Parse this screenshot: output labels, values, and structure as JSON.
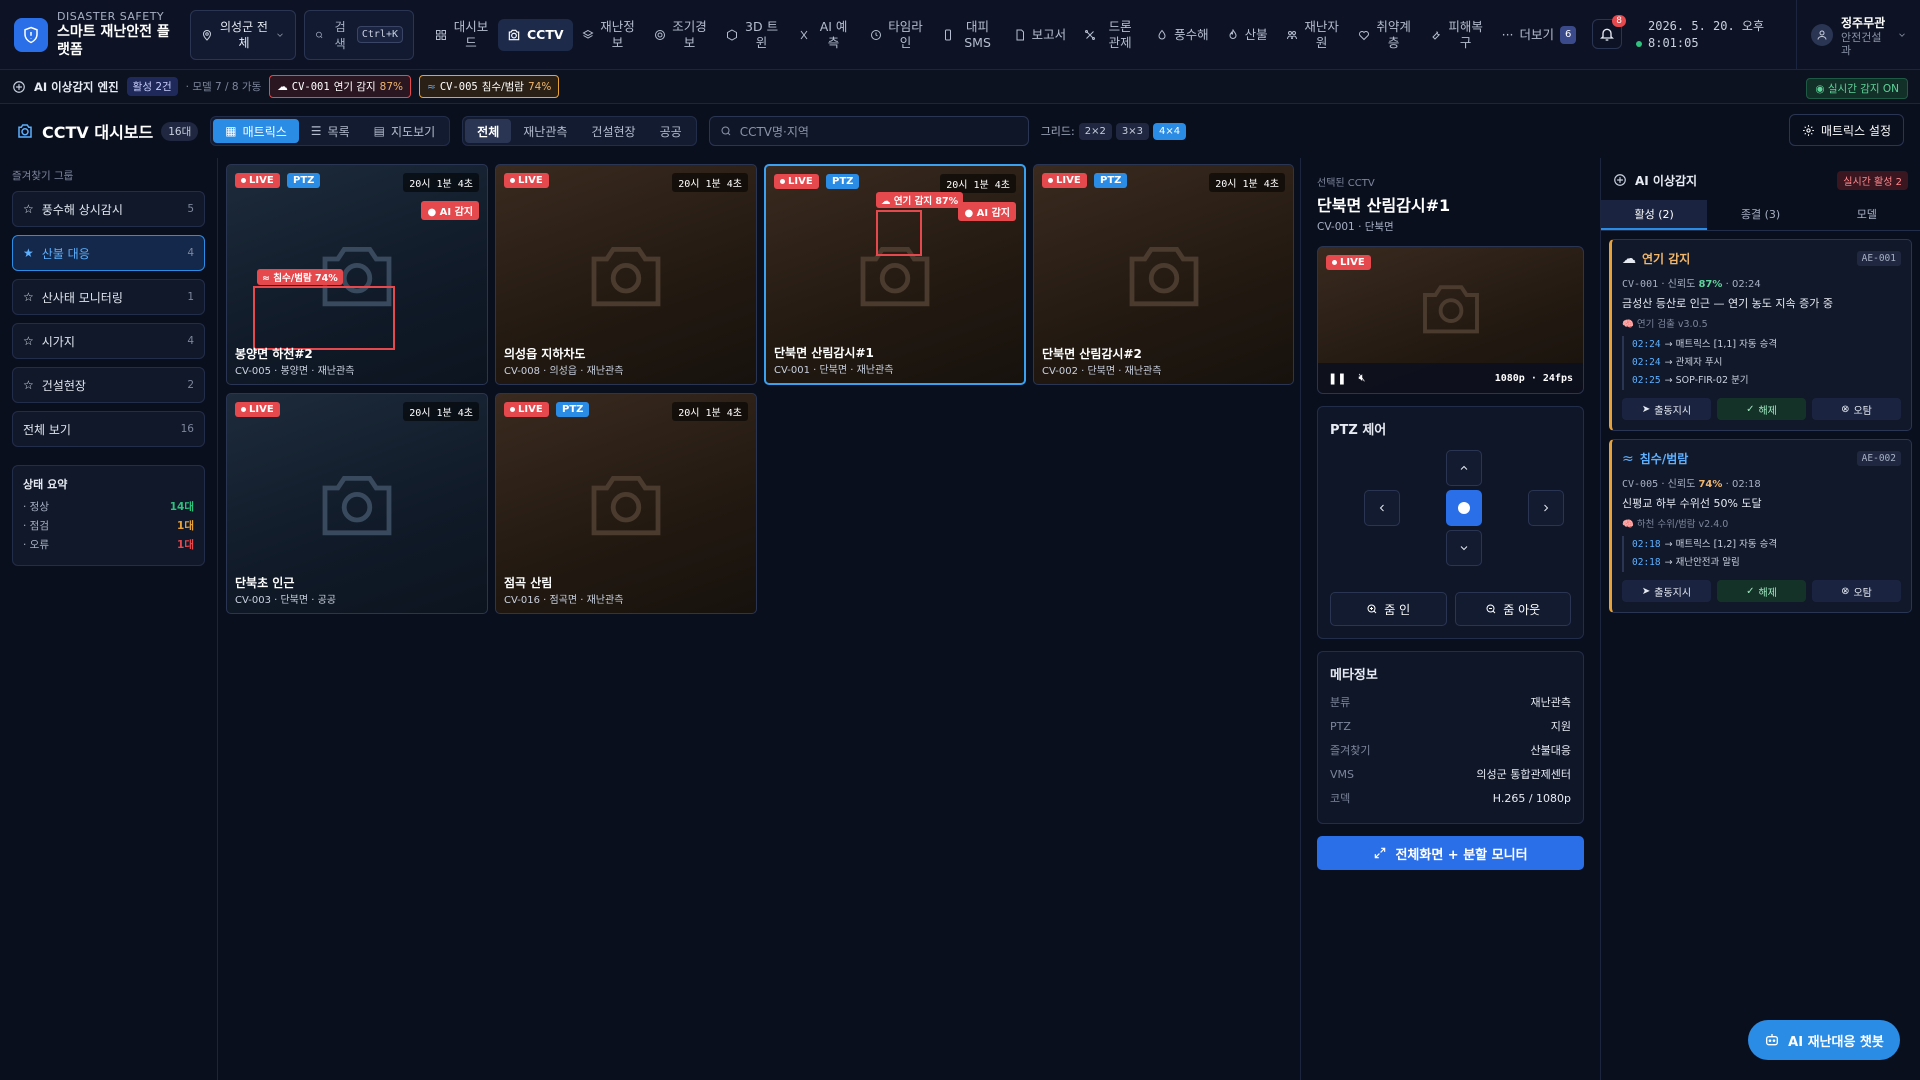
{
  "brand": {
    "sub": "DISASTER SAFETY",
    "title": "스마트 재난안전 플랫폼"
  },
  "region": {
    "label": "의성군 전체"
  },
  "search": {
    "label": "검색",
    "shortcut": "Ctrl+K"
  },
  "nav": [
    {
      "label": "대시보드",
      "icon": "grid-icon"
    },
    {
      "label": "CCTV",
      "icon": "camera-icon",
      "active": true
    },
    {
      "label": "재난정보",
      "icon": "layers-icon"
    },
    {
      "label": "조기경보",
      "icon": "radar-icon"
    },
    {
      "label": "3D 트윈",
      "icon": "cube-icon"
    },
    {
      "label": "AI 예측",
      "icon": "ai-icon"
    },
    {
      "label": "타임라인",
      "icon": "clock-icon"
    },
    {
      "label": "대피 SMS",
      "icon": "phone-icon"
    },
    {
      "label": "보고서",
      "icon": "document-icon"
    },
    {
      "label": "드론 관제",
      "icon": "drone-icon"
    },
    {
      "label": "풍수해",
      "icon": "storm-icon"
    },
    {
      "label": "산불",
      "icon": "fire-icon"
    },
    {
      "label": "재난자원",
      "icon": "resource-icon"
    },
    {
      "label": "취약계층",
      "icon": "heart-icon"
    },
    {
      "label": "피해복구",
      "icon": "wrench-icon"
    },
    {
      "label": "더보기",
      "icon": "more-icon",
      "badge": "6"
    }
  ],
  "notifications": {
    "count": "8"
  },
  "clock": {
    "date": "2026. 5. 20. 오후",
    "time": "8:01:05"
  },
  "user": {
    "name": "정주무관",
    "role": "안전건설과"
  },
  "ai_strip": {
    "engine": "AI 이상감지 엔진",
    "active": "활성 2건",
    "models": "· 모델 7 / 8 가동",
    "alerts": [
      {
        "cam": "CV-001",
        "text": "연기 감지",
        "pct": "87%"
      },
      {
        "cam": "CV-005",
        "text": "침수/범람",
        "pct": "74%"
      }
    ],
    "realtime": "실시간 감지 ON"
  },
  "dashboard": {
    "title": "CCTV 대시보드",
    "count": "16대",
    "views": [
      "매트릭스",
      "목록",
      "지도보기"
    ],
    "filters": [
      "전체",
      "재난관측",
      "건설현장",
      "공공"
    ],
    "search_placeholder": "CCTV명·지역",
    "grid_label": "그리드:",
    "grids": [
      "2×2",
      "3×3",
      "4×4"
    ],
    "settings": "매트릭스 설정"
  },
  "sidebar": {
    "group_label": "즐겨찾기 그룹",
    "items": [
      {
        "label": "풍수해 상시감시",
        "count": "5"
      },
      {
        "label": "산불 대응",
        "count": "4",
        "active": true
      },
      {
        "label": "산사태 모니터링",
        "count": "1"
      },
      {
        "label": "시가지",
        "count": "4"
      },
      {
        "label": "건설현장",
        "count": "2"
      },
      {
        "label": "전체 보기",
        "count": "16"
      }
    ],
    "summary": {
      "title": "상태 요약",
      "rows": [
        {
          "label": "· 정상",
          "value": "14대",
          "color": "#2ec27e"
        },
        {
          "label": "· 점검",
          "value": "1대",
          "color": "#e8a23a"
        },
        {
          "label": "· 오류",
          "value": "1대",
          "color": "#e5484d"
        }
      ]
    }
  },
  "tiles": [
    {
      "live": "LIVE",
      "ptz": "PTZ",
      "time": "20시 1분 4초",
      "ai": "AI 감지",
      "name": "봉양면 하천#2",
      "meta": "CV-005 · 봉양면 · 재난관측",
      "detection": "침수/범람 74%"
    },
    {
      "live": "LIVE",
      "time": "20시 1분 4초",
      "name": "의성읍 지하차도",
      "meta": "CV-008 · 의성읍 · 재난관측"
    },
    {
      "live": "LIVE",
      "ptz": "PTZ",
      "time": "20시 1분 4초",
      "ai": "AI 감지",
      "name": "단북면 산림감시#1",
      "meta": "CV-001 · 단북면 · 재난관측",
      "detection": "연기 감지 87%"
    },
    {
      "live": "LIVE",
      "ptz": "PTZ",
      "time": "20시 1분 4초",
      "name": "단북면 산림감시#2",
      "meta": "CV-002 · 단북면 · 재난관측"
    },
    {
      "live": "LIVE",
      "time": "20시 1분 4초",
      "name": "단북초 인근",
      "meta": "CV-003 · 단북면 · 공공"
    },
    {
      "live": "LIVE",
      "ptz": "PTZ",
      "time": "20시 1분 4초",
      "name": "점곡 산림",
      "meta": "CV-016 · 점곡면 · 재난관측"
    }
  ],
  "detail": {
    "selected_label": "선택된 CCTV",
    "name": "단북면 산림감시#1",
    "meta": "CV-001 · 단북면",
    "live": "LIVE",
    "resolution": "1080p · 24fps",
    "ptz_title": "PTZ 제어",
    "zoom_in": "줌 인",
    "zoom_out": "줌 아웃",
    "meta_title": "메타정보",
    "meta_rows": [
      {
        "k": "분류",
        "v": "재난관측"
      },
      {
        "k": "PTZ",
        "v": "지원"
      },
      {
        "k": "즐겨찾기",
        "v": "산불대응"
      },
      {
        "k": "VMS",
        "v": "의성군 통합관제센터"
      },
      {
        "k": "코덱",
        "v": "H.265 / 1080p"
      }
    ],
    "fullscreen": "전체화면 + 분할 모니터"
  },
  "aipanel": {
    "title": "AI 이상감지",
    "active": "실시간 활성 2",
    "tabs": [
      "활성 (2)",
      "종결 (3)",
      "모델"
    ],
    "cards": [
      {
        "title": "연기 감지",
        "id": "AE-001",
        "cam": "CV-001",
        "conf_label": "· 신뢰도",
        "conf": "87%",
        "time": "· 02:24",
        "desc": "금성산 등산로 인근 — 연기 농도 지속 증가 중",
        "model": "연기 검출 v3.0.5",
        "steps": [
          {
            "t": "02:24",
            "s": "→ 매트릭스 [1,1] 자동 승격"
          },
          {
            "t": "02:24",
            "s": "→ 관제자 푸시"
          },
          {
            "t": "02:25",
            "s": "→ SOP-FIR-02 분기"
          }
        ]
      },
      {
        "title": "침수/범람",
        "id": "AE-002",
        "cam": "CV-005",
        "conf_label": "· 신뢰도",
        "conf": "74%",
        "time": "· 02:18",
        "desc": "신평교 하부 수위선 50% 도달",
        "model": "하천 수위/범람 v2.4.0",
        "steps": [
          {
            "t": "02:18",
            "s": "→ 매트릭스 [1,2] 자동 승격"
          },
          {
            "t": "02:18",
            "s": "→ 재난안전과 알림"
          }
        ]
      }
    ],
    "actions": [
      "출동지시",
      "해제",
      "오탐"
    ]
  },
  "chatbot": {
    "label": "AI 재난대응 챗봇"
  }
}
